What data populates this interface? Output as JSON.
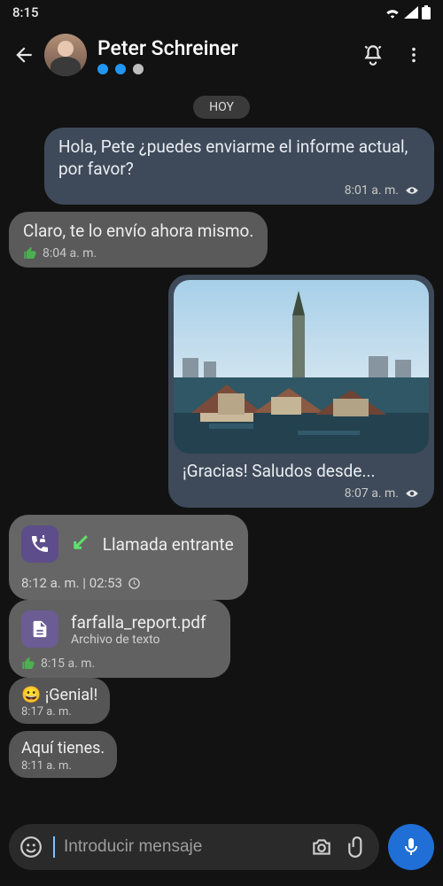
{
  "statusbar": {
    "time": "8:15"
  },
  "header": {
    "name": "Peter Schreiner"
  },
  "day_label": "HOY",
  "msgs": {
    "m1": {
      "text": "Hola, Pete ¿puedes enviarme el informe actual, por favor?",
      "time": "8:01 a. m."
    },
    "m2": {
      "text": "Claro, te lo envío ahora mismo.",
      "time": "8:04 a. m."
    },
    "m3": {
      "caption": "¡Gracias! Saludos desde...",
      "time": "8:07 a. m."
    },
    "call": {
      "title": "Llamada entrante",
      "meta": "8:12 a. m. | 02:53"
    },
    "file": {
      "name": "farfalla_report.pdf",
      "sub": "Archivo de texto",
      "time": "8:15 a. m."
    },
    "m4": {
      "text": "😀 ¡Genial!",
      "time": "8:17 a. m."
    },
    "m5": {
      "text": "Aquí tienes.",
      "time": "8:11 a. m."
    }
  },
  "composer": {
    "placeholder": "Introducir mensaje"
  }
}
